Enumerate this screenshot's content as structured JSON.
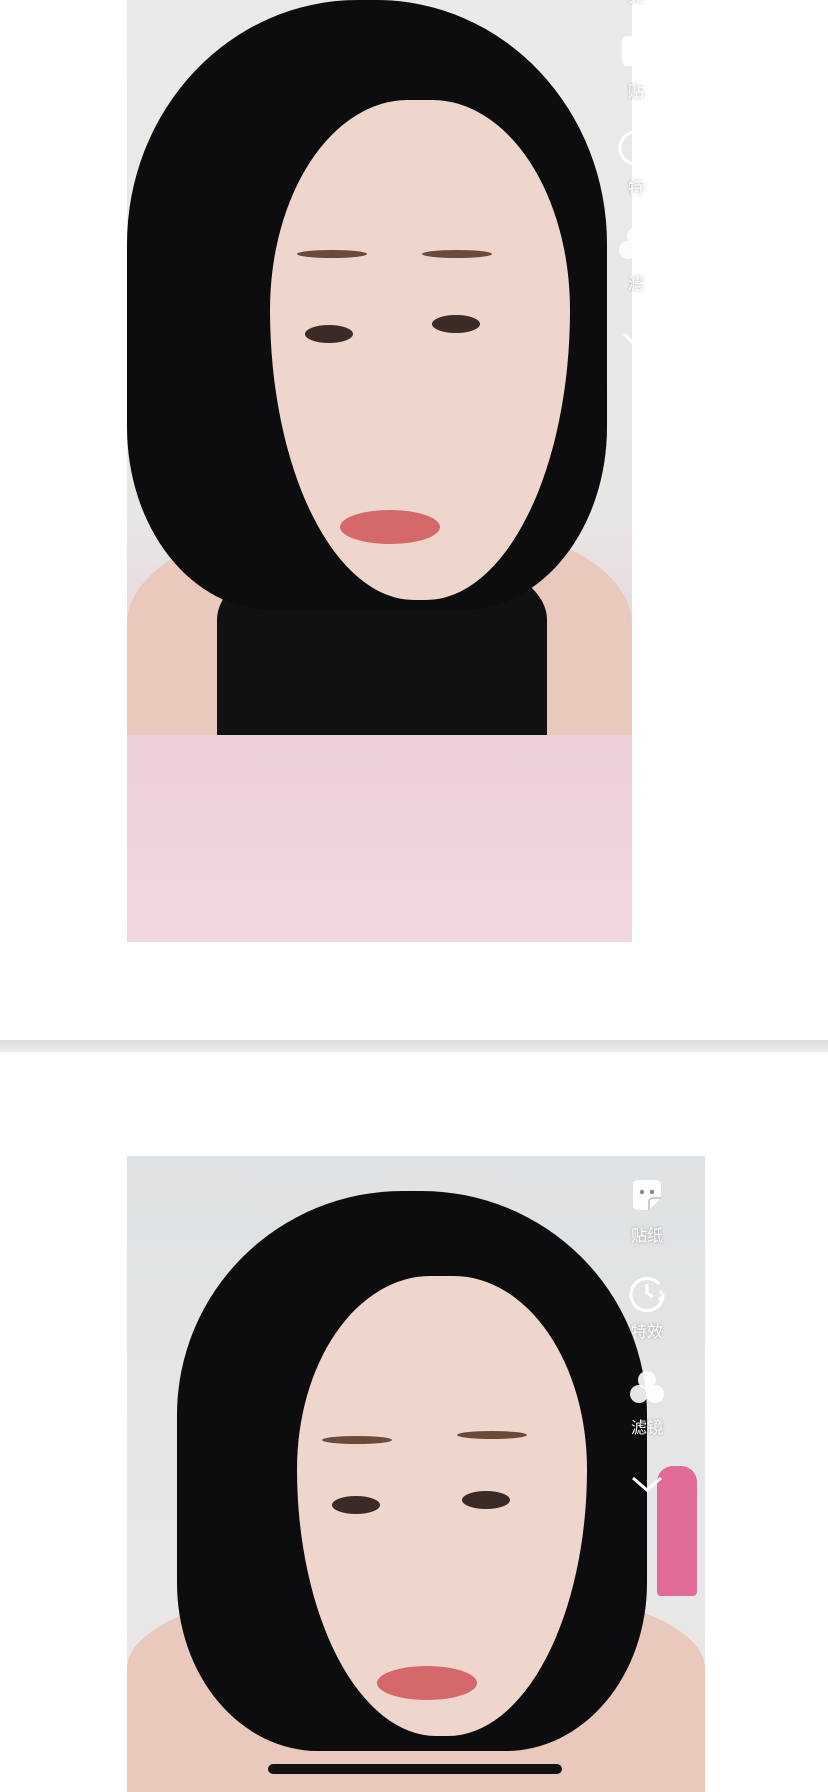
{
  "top_screenshot": {
    "toolbar": {
      "cut_text_label": "文",
      "items": [
        {
          "icon": "sticker-icon",
          "label": "贴"
        },
        {
          "icon": "effects-icon",
          "label": "特"
        },
        {
          "icon": "filter-icon",
          "label": "滤"
        },
        {
          "icon": "chevron-down-icon",
          "label": ""
        }
      ]
    }
  },
  "bottom_screenshot": {
    "toolbar": {
      "items": [
        {
          "icon": "sticker-icon",
          "label": "贴纸"
        },
        {
          "icon": "effects-icon",
          "label": "特效"
        },
        {
          "icon": "filter-icon",
          "label": "滤镜"
        },
        {
          "icon": "chevron-down-icon",
          "label": ""
        }
      ]
    }
  },
  "colors": {
    "divider": "#dcdcdc",
    "toolbar_text": "#ffffff",
    "hair": "#0d0d0f",
    "bedsheet": "#eccfdb"
  }
}
